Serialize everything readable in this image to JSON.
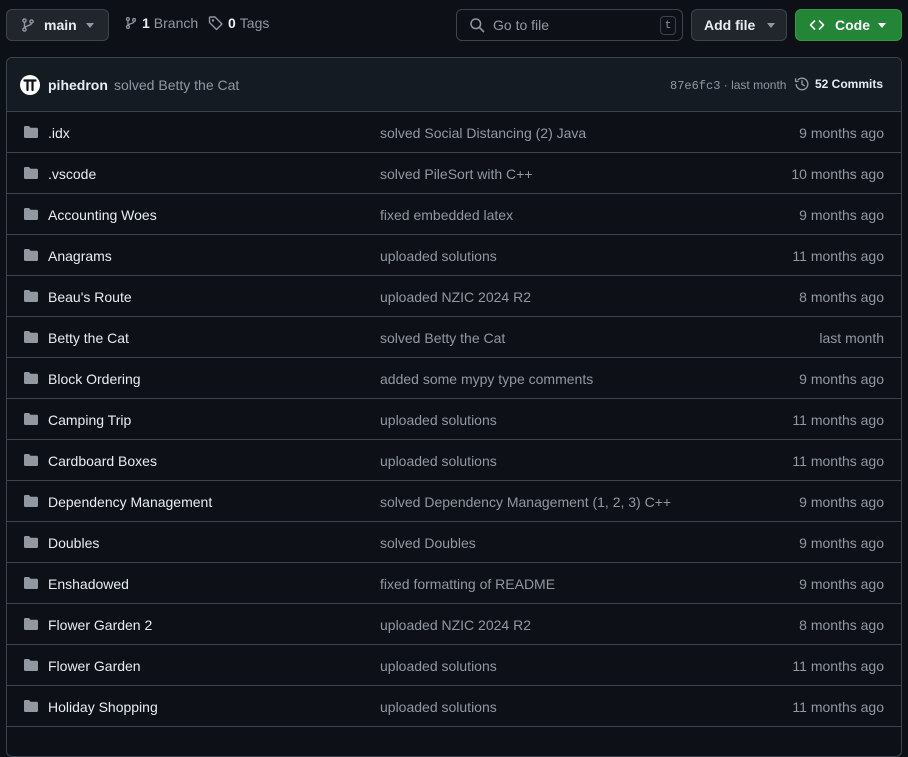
{
  "toolbar": {
    "branch_name": "main",
    "branch_count": "1",
    "branch_word": "Branch",
    "tag_count": "0",
    "tag_word": "Tags",
    "search_placeholder": "Go to file",
    "search_shortcut": "t",
    "add_file_label": "Add file",
    "code_label": "Code"
  },
  "commit": {
    "author": "pihedron",
    "message": "solved Betty the Cat",
    "hash": "87e6fc3",
    "separator": " · ",
    "time": "last month",
    "commits_label": "52 Commits"
  },
  "files": [
    {
      "name": ".idx",
      "message": "solved Social Distancing (2) Java",
      "age": "9 months ago"
    },
    {
      "name": ".vscode",
      "message": "solved PileSort with C++",
      "age": "10 months ago"
    },
    {
      "name": "Accounting Woes",
      "message": "fixed embedded latex",
      "age": "9 months ago"
    },
    {
      "name": "Anagrams",
      "message": "uploaded solutions",
      "age": "11 months ago"
    },
    {
      "name": "Beau's Route",
      "message": "uploaded NZIC 2024 R2",
      "age": "8 months ago"
    },
    {
      "name": "Betty the Cat",
      "message": "solved Betty the Cat",
      "age": "last month"
    },
    {
      "name": "Block Ordering",
      "message": "added some mypy type comments",
      "age": "9 months ago"
    },
    {
      "name": "Camping Trip",
      "message": "uploaded solutions",
      "age": "11 months ago"
    },
    {
      "name": "Cardboard Boxes",
      "message": "uploaded solutions",
      "age": "11 months ago"
    },
    {
      "name": "Dependency Management",
      "message": "solved Dependency Management (1, 2, 3) C++",
      "age": "9 months ago"
    },
    {
      "name": "Doubles",
      "message": "solved Doubles",
      "age": "9 months ago"
    },
    {
      "name": "Enshadowed",
      "message": "fixed formatting of README",
      "age": "9 months ago"
    },
    {
      "name": "Flower Garden 2",
      "message": "uploaded NZIC 2024 R2",
      "age": "8 months ago"
    },
    {
      "name": "Flower Garden",
      "message": "uploaded solutions",
      "age": "11 months ago"
    },
    {
      "name": "Holiday Shopping",
      "message": "uploaded solutions",
      "age": "11 months ago"
    }
  ],
  "colors": {
    "background": "#0d1117",
    "header_bg": "#151b23",
    "border": "#3d444d",
    "muted_text": "#9198a1",
    "primary_text": "#e6edf3",
    "code_button": "#238636",
    "folder_icon": "#9198a1"
  },
  "icons": {
    "branch": "git-branch-icon",
    "tag": "tag-icon",
    "search": "search-icon",
    "code": "code-icon",
    "history": "history-icon",
    "folder": "folder-icon"
  }
}
